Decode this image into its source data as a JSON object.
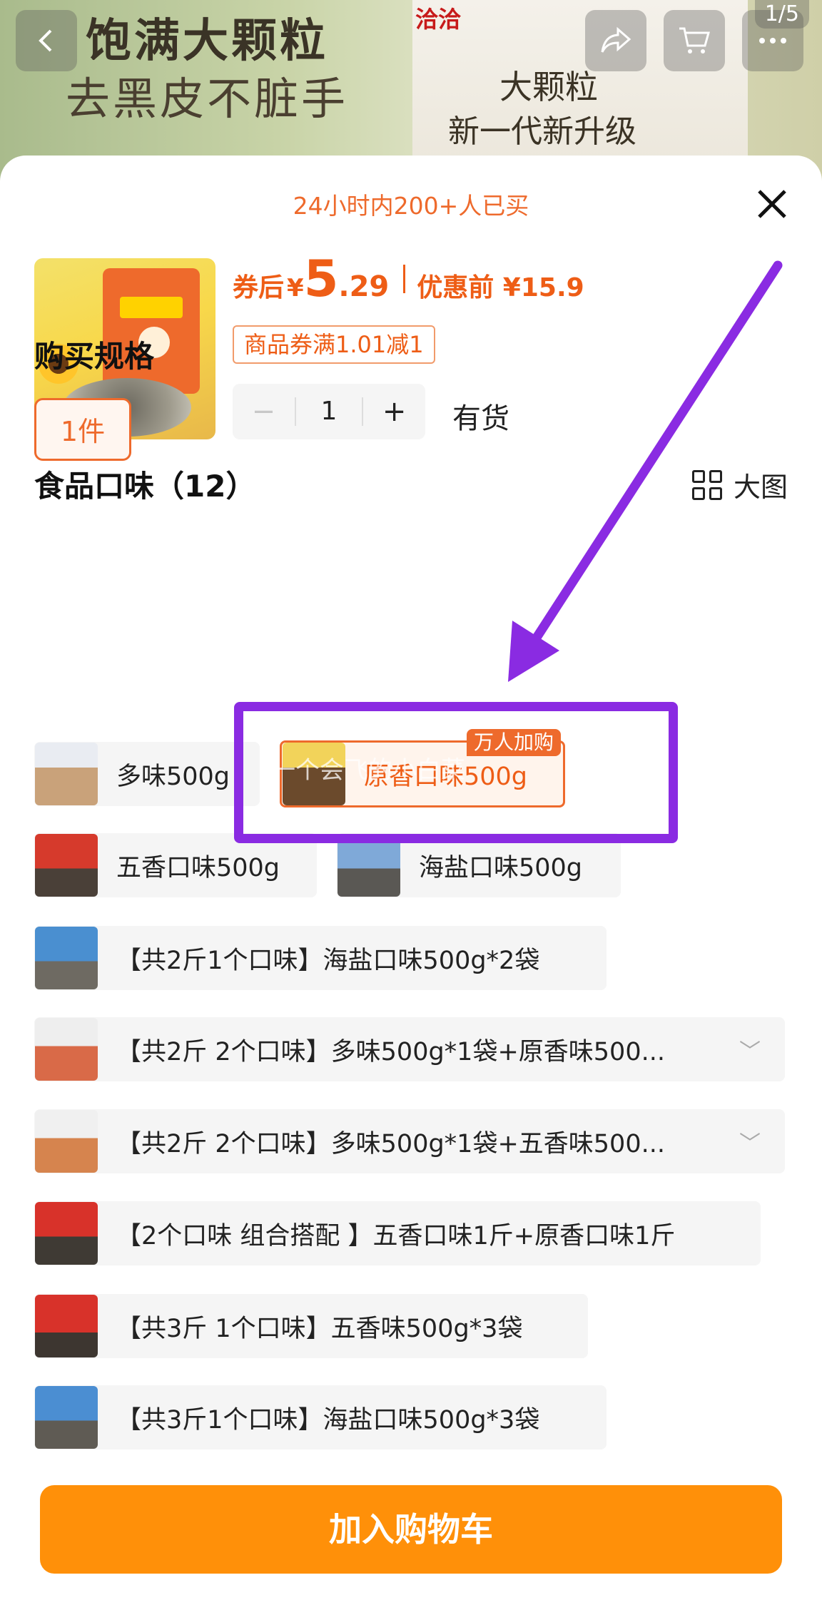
{
  "colors": {
    "accent": "#ee6a2c",
    "price": "#ee5d16",
    "cta": "#ff9009",
    "annotation": "#8a2be2"
  },
  "background": {
    "headline": "饱满大颗粒",
    "subline": "去黑皮不脏手",
    "brand": "洽洽",
    "pack_line1": "大颗粒",
    "pack_line2": "新一代新升级",
    "pager": "1/5",
    "icons": [
      "back-icon",
      "share-icon",
      "cart-icon",
      "more-icon"
    ]
  },
  "sheet": {
    "buy_count": "24小时内200+人已买",
    "price": {
      "after_label": "券后",
      "currency": "¥",
      "integer": "5",
      "decimal": ".29",
      "before_label": "优惠前 ¥15.9"
    },
    "coupon": "商品券满1.01减1",
    "quantity": {
      "minus": "−",
      "value": "1",
      "plus": "+"
    },
    "stock": "有货",
    "spec_title": "购买规格",
    "spec_option": "1件",
    "flavor_title": "食品口味（12）",
    "big_view": "大图",
    "flavor_options": [
      {
        "label": "多味500g"
      },
      {
        "label": "原香口味500g",
        "badge": "万人加购",
        "selected": true
      },
      {
        "label": "五香口味500g"
      },
      {
        "label": "海盐口味500g"
      },
      {
        "label": "【共2斤1个口味】海盐口味500g*2袋"
      },
      {
        "label": "【共2斤 2个口味】多味500g*1袋+原香味500..."
      },
      {
        "label": "【共2斤 2个口味】多味500g*1袋+五香味500..."
      },
      {
        "label": "【2个口味 组合搭配 】五香口味1斤+原香口味1斤"
      },
      {
        "label": "【共3斤 1个口味】五香味500g*3袋"
      },
      {
        "label": "【共3斤1个口味】海盐口味500g*3袋"
      }
    ],
    "watermark": "一个会飞的小白菜",
    "add_to_cart": "加入购物车"
  }
}
